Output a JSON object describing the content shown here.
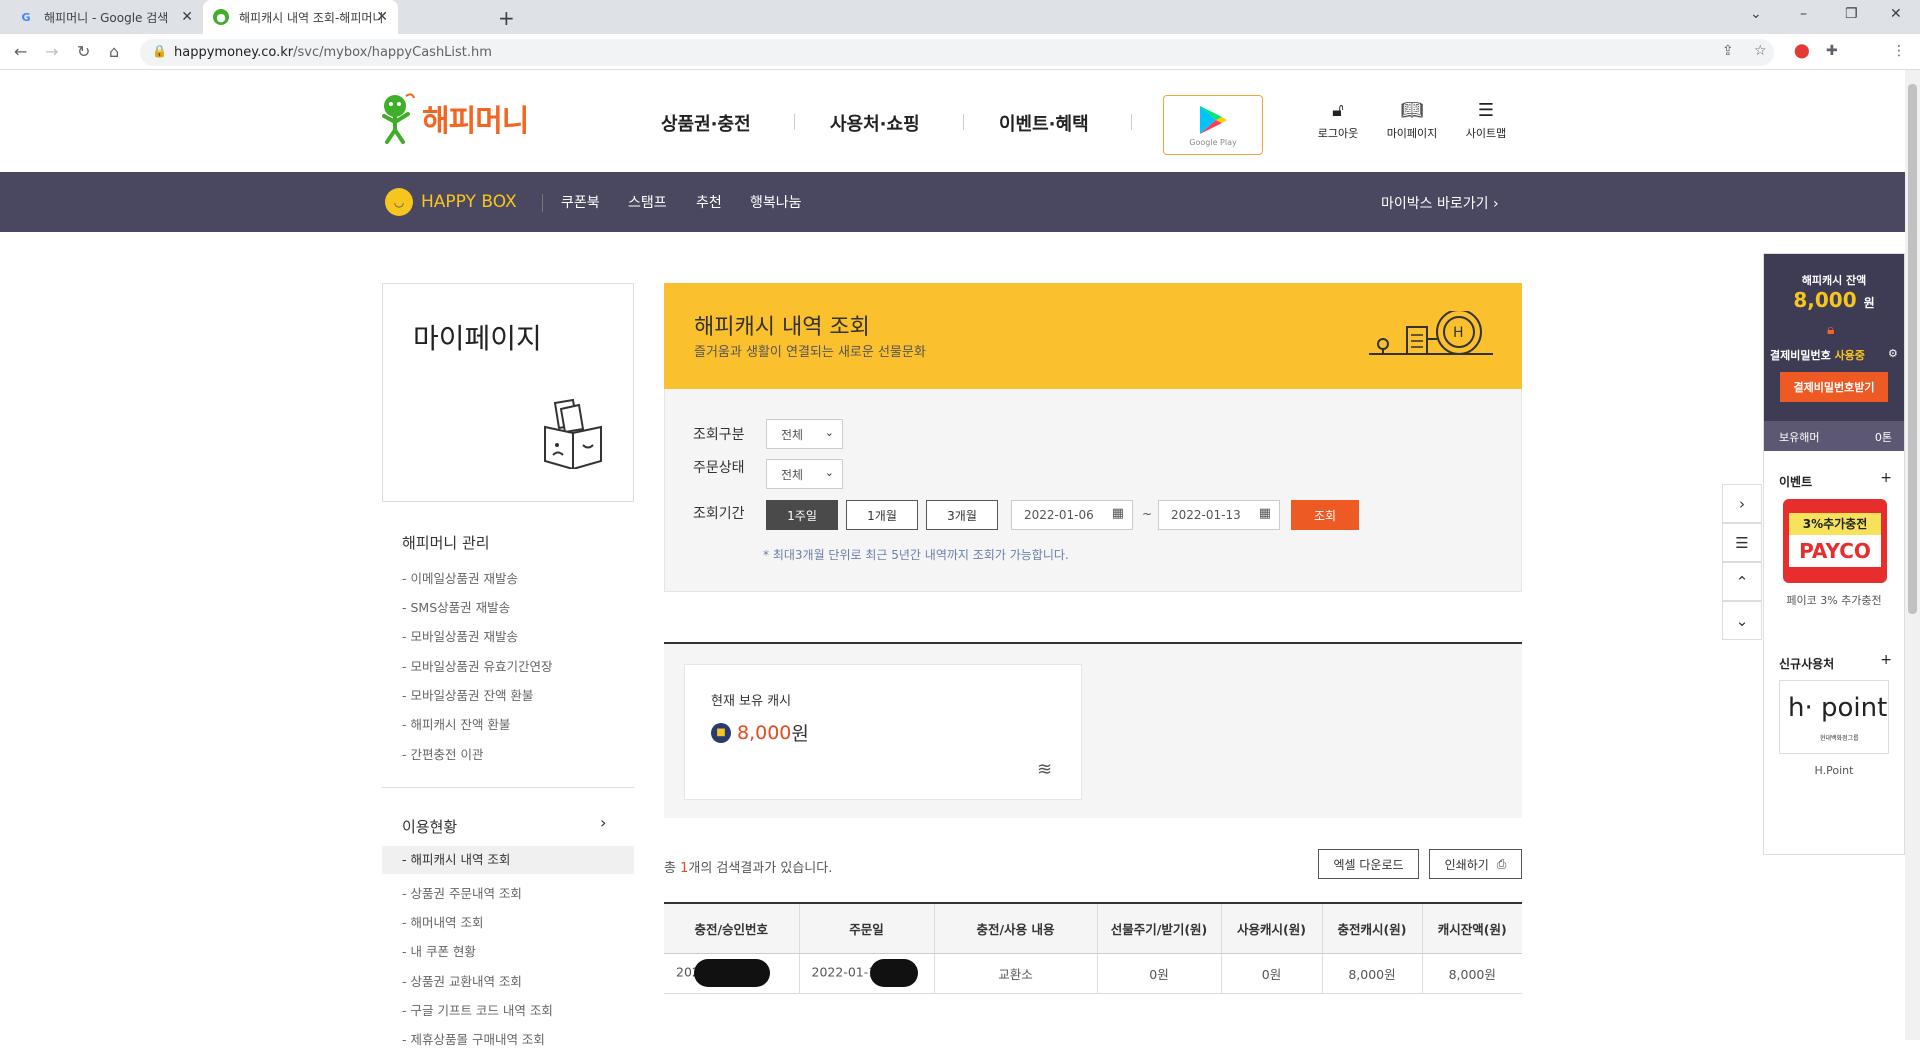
{
  "browser": {
    "tabs": [
      {
        "title": "해피머니 - Google 검색",
        "favicon": "google-icon"
      },
      {
        "title": "해피캐시 내역 조회-해피머니",
        "favicon": "happymoney-icon"
      }
    ],
    "url_domain": "happymoney.co.kr",
    "url_path": "/svc/mybox/happyCashList.hm"
  },
  "header": {
    "logo": "해피머니",
    "nav": [
      "상품권·충전",
      "사용처·쇼핑",
      "이벤트·혜택"
    ],
    "google_play": "Google Play",
    "utils": [
      {
        "label": "로그아웃",
        "icon": "lock-open-icon"
      },
      {
        "label": "마이페이지",
        "icon": "book-icon"
      },
      {
        "label": "사이트맵",
        "icon": "menu-icon"
      }
    ]
  },
  "happybox": {
    "logo": "HAPPY BOX",
    "menu": [
      "쿠폰북",
      "스탬프",
      "추천",
      "행복나눔"
    ],
    "shortcut": "마이박스 바로가기 ›"
  },
  "sidebar": {
    "title": "마이페이지",
    "section1_title": "해피머니 관리",
    "section1_items": [
      "- 이메일상품권 재발송",
      "- SMS상품권 재발송",
      "- 모바일상품권 재발송",
      "- 모바일상품권 유효기간연장",
      "- 모바일상품권 잔액 환불",
      "- 해피캐시 잔액 환불",
      "- 간편충전 이관"
    ],
    "section2_title": "이용현황",
    "section2_items": [
      "- 해피캐시 내역 조회",
      "- 상품권 주문내역 조회",
      "- 해머내역 조회",
      "- 내 쿠폰 현황",
      "- 상품권 교환내역 조회",
      "- 구글 기프트 코드 내역 조회",
      "- 제휴상품몰 구매내역 조회"
    ]
  },
  "main": {
    "banner_title": "해피캐시 내역 조회",
    "banner_subtitle": "즐거움과 생활이 연결되는 새로운 선물문화",
    "filter": {
      "type_label": "조회구분",
      "type_value": "전체",
      "status_label": "주문상태",
      "status_value": "전체",
      "period_label": "조회기간",
      "period_buttons": [
        "1주일",
        "1개월",
        "3개월"
      ],
      "active_period": "1주일",
      "date_from": "2022-01-06",
      "tilde": "~",
      "date_to": "2022-01-13",
      "search_button": "조회",
      "note": "* 최대3개월 단위로 최근 5년간 내역까지 조회가 가능합니다."
    },
    "summary": {
      "label": "현재 보유 캐시",
      "amount": "8,000",
      "unit": "원"
    },
    "result": {
      "prefix": "총 ",
      "count": "1",
      "suffix": "개의 검색결과가 있습니다.",
      "excel_button": "엑셀 다운로드",
      "print_button": "인쇄하기"
    },
    "table": {
      "headers": [
        "충전/승인번호",
        "주문일",
        "충전/사용 내용",
        "선물주기/받기(원)",
        "사용캐시(원)",
        "충전캐시(원)",
        "캐시잔액(원)"
      ],
      "rows": [
        [
          "2022",
          "2022-01-13",
          "교환소",
          "0원",
          "0원",
          "8,000원",
          "8,000원"
        ]
      ]
    }
  },
  "quickmenu": {
    "balance_label": "해피캐시 잔액",
    "balance": "8,000",
    "balance_unit": "원",
    "pw_label": "결제비밀번호 ",
    "pw_state": "사용중",
    "pw_button": "결제비밀번호받기",
    "hold_label": "보유해머",
    "hold_value": "0톤",
    "event_title": "이벤트",
    "event_banner_top": "3%추가충전",
    "event_banner_brand": "PAYCO",
    "event_caption": "페이코 3% 추가충전",
    "partner_title": "신규사용처",
    "partner_logo": "h· point",
    "partner_logo_sub": "현대백화점그룹",
    "partner_caption": "H.Point"
  },
  "colors": {
    "accent": "#ee5a24",
    "banner": "#fbc02d",
    "happybox_bar": "#4a4760"
  }
}
